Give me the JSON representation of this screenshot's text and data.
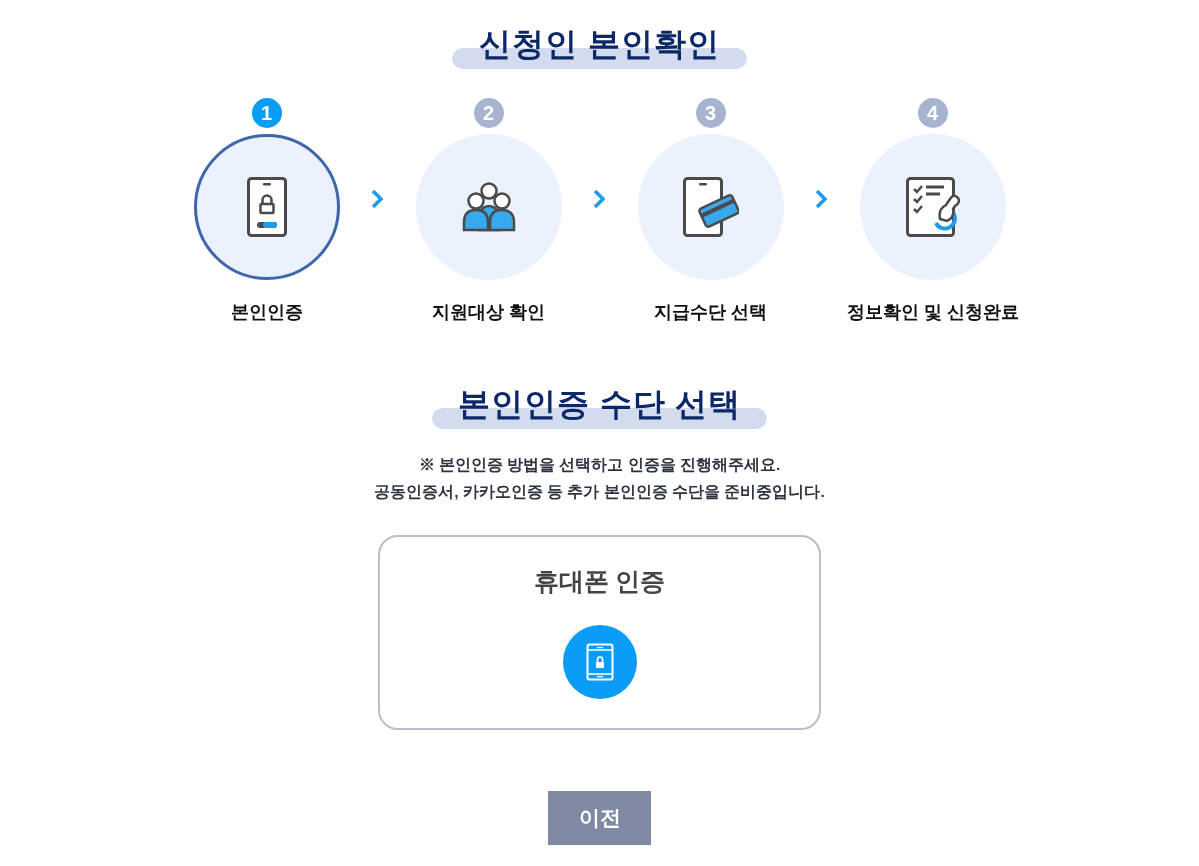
{
  "page_title": "신청인 본인확인",
  "steps": [
    {
      "number": "1",
      "label": "본인인증",
      "selected": true
    },
    {
      "number": "2",
      "label": "지원대상 확인",
      "selected": false
    },
    {
      "number": "3",
      "label": "지급수단 선택",
      "selected": false
    },
    {
      "number": "4",
      "label": "정보확인 및 신청완료",
      "selected": false
    }
  ],
  "section_title": "본인인증 수단 선택",
  "notes": [
    "※ 본인인증 방법을 선택하고 인증을 진행해주세요.",
    "공동인증서, 카카오인증 등 추가 본인인증 수단을 준비중입니다."
  ],
  "methods": [
    {
      "label": "휴대폰 인증"
    }
  ],
  "buttons": [
    "이전"
  ]
}
